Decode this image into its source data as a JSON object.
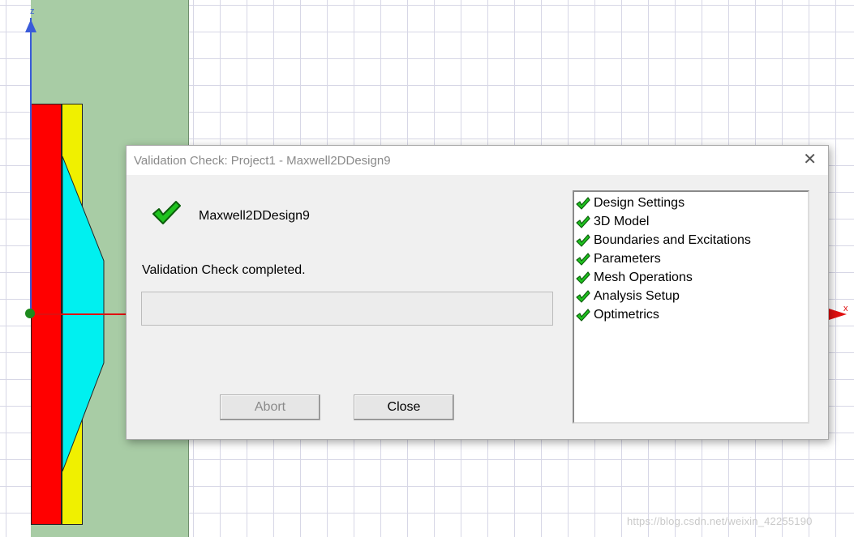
{
  "viewport": {
    "axis_z_label": "z",
    "axis_x_label": "x",
    "watermark": "https://blog.csdn.net/weixin_42255190"
  },
  "dialog": {
    "title": "Validation Check: Project1 - Maxwell2DDesign9",
    "close_glyph": "✕",
    "design_name": "Maxwell2DDesign9",
    "status": "Validation Check completed.",
    "progress": 0,
    "buttons": {
      "abort_label": "Abort",
      "abort_enabled": false,
      "close_label": "Close"
    },
    "checks": [
      {
        "label": "Design Settings",
        "status": "ok"
      },
      {
        "label": "3D Model",
        "status": "ok"
      },
      {
        "label": "Boundaries and Excitations",
        "status": "ok"
      },
      {
        "label": "Parameters",
        "status": "ok"
      },
      {
        "label": "Mesh Operations",
        "status": "ok"
      },
      {
        "label": "Analysis Setup",
        "status": "ok"
      },
      {
        "label": "Optimetrics",
        "status": "ok"
      }
    ],
    "icon": "green-checkmark-icon"
  },
  "colors": {
    "green_region": "#a8cca5",
    "red_strip": "#ff0000",
    "yellow_strip": "#f0f000",
    "cyan_shape": "#00f0f0",
    "check_green": "#1fc31f"
  }
}
